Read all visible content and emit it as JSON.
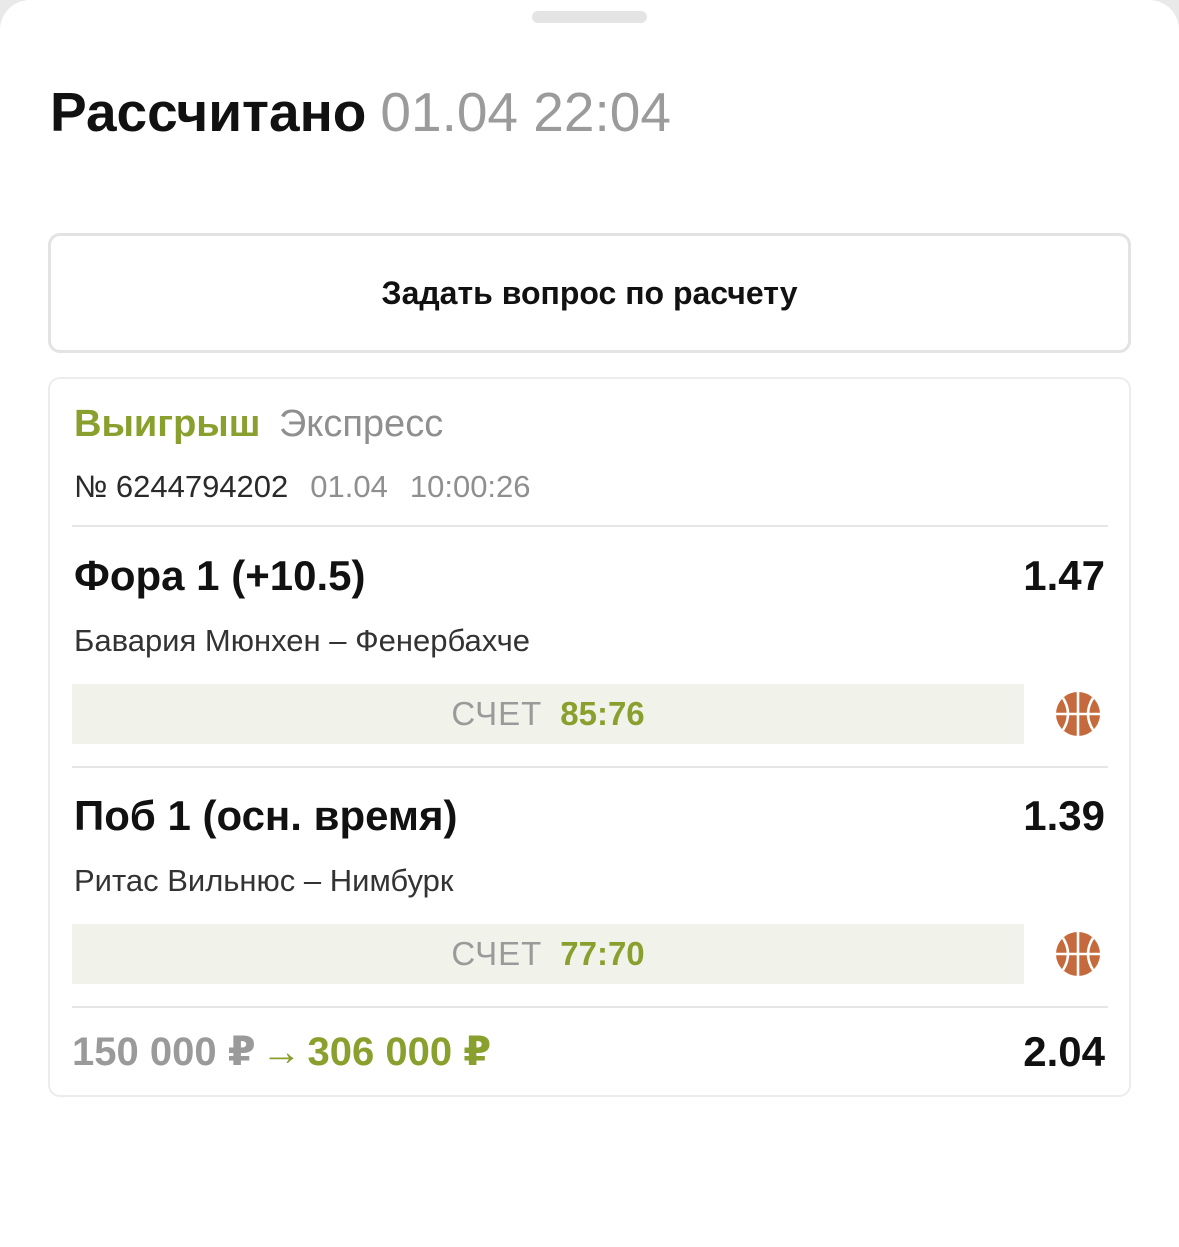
{
  "header": {
    "status": "Рассчитано",
    "datetime": "01.04 22:04"
  },
  "ask_button_label": "Задать вопрос по расчету",
  "bet": {
    "result": "Выигрыш",
    "type": "Экспресс",
    "number": "№ 6244794202",
    "date": "01.04",
    "time": "10:00:26",
    "selections": [
      {
        "market": "Фора 1 (+10.5)",
        "odds": "1.47",
        "event": "Бавария Мюнхен – Фенербахче",
        "score_label": "СЧЕТ",
        "score": "85:76",
        "sport_icon": "basketball-icon"
      },
      {
        "market": "Поб 1 (осн. время)",
        "odds": "1.39",
        "event": "Ритас Вильнюс – Нимбурк",
        "score_label": "СЧЕТ",
        "score": "77:70",
        "sport_icon": "basketball-icon"
      }
    ],
    "stake": "150 000 ₽",
    "arrow": "→",
    "payout": "306 000 ₽",
    "total_odds": "2.04"
  },
  "colors": {
    "win_green": "#8aa02e",
    "score_bg": "#f1f2ea",
    "basketball": "#c56a3c"
  }
}
